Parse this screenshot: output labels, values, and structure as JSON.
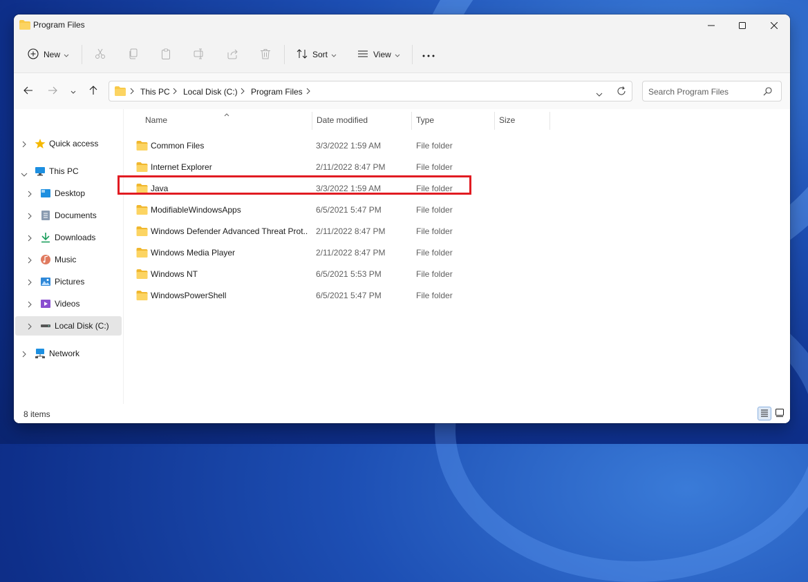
{
  "window": {
    "title": "Program Files"
  },
  "toolbar": {
    "new_label": "New",
    "sort_label": "Sort",
    "view_label": "View"
  },
  "address": {
    "crumbs": [
      "This PC",
      "Local Disk (C:)",
      "Program Files"
    ]
  },
  "search": {
    "placeholder": "Search Program Files"
  },
  "sidebar": {
    "items": [
      {
        "label": "Quick access",
        "icon": "star-icon"
      },
      {
        "label": "This PC",
        "icon": "computer-icon"
      },
      {
        "label": "Desktop",
        "icon": "desktop-icon"
      },
      {
        "label": "Documents",
        "icon": "documents-icon"
      },
      {
        "label": "Downloads",
        "icon": "download-icon"
      },
      {
        "label": "Music",
        "icon": "music-icon"
      },
      {
        "label": "Pictures",
        "icon": "pictures-icon"
      },
      {
        "label": "Videos",
        "icon": "videos-icon"
      },
      {
        "label": "Local Disk (C:)",
        "icon": "drive-icon",
        "selected": true
      },
      {
        "label": "Network",
        "icon": "network-icon"
      }
    ]
  },
  "columns": {
    "name": "Name",
    "date": "Date modified",
    "type": "Type",
    "size": "Size"
  },
  "files": [
    {
      "name": "Common Files",
      "date": "3/3/2022 1:59 AM",
      "type": "File folder"
    },
    {
      "name": "Internet Explorer",
      "date": "2/11/2022 8:47 PM",
      "type": "File folder"
    },
    {
      "name": "Java",
      "date": "3/3/2022 1:59 AM",
      "type": "File folder",
      "highlighted": true
    },
    {
      "name": "ModifiableWindowsApps",
      "date": "6/5/2021 5:47 PM",
      "type": "File folder"
    },
    {
      "name": "Windows Defender Advanced Threat Prot...",
      "date": "2/11/2022 8:47 PM",
      "type": "File folder"
    },
    {
      "name": "Windows Media Player",
      "date": "2/11/2022 8:47 PM",
      "type": "File folder"
    },
    {
      "name": "Windows NT",
      "date": "6/5/2021 5:53 PM",
      "type": "File folder"
    },
    {
      "name": "WindowsPowerShell",
      "date": "6/5/2021 5:47 PM",
      "type": "File folder"
    }
  ],
  "status": {
    "item_count": "8 items"
  },
  "colors": {
    "folder": "#f8c948",
    "highlight_border": "#e11b22",
    "accent": "#0067c0"
  }
}
